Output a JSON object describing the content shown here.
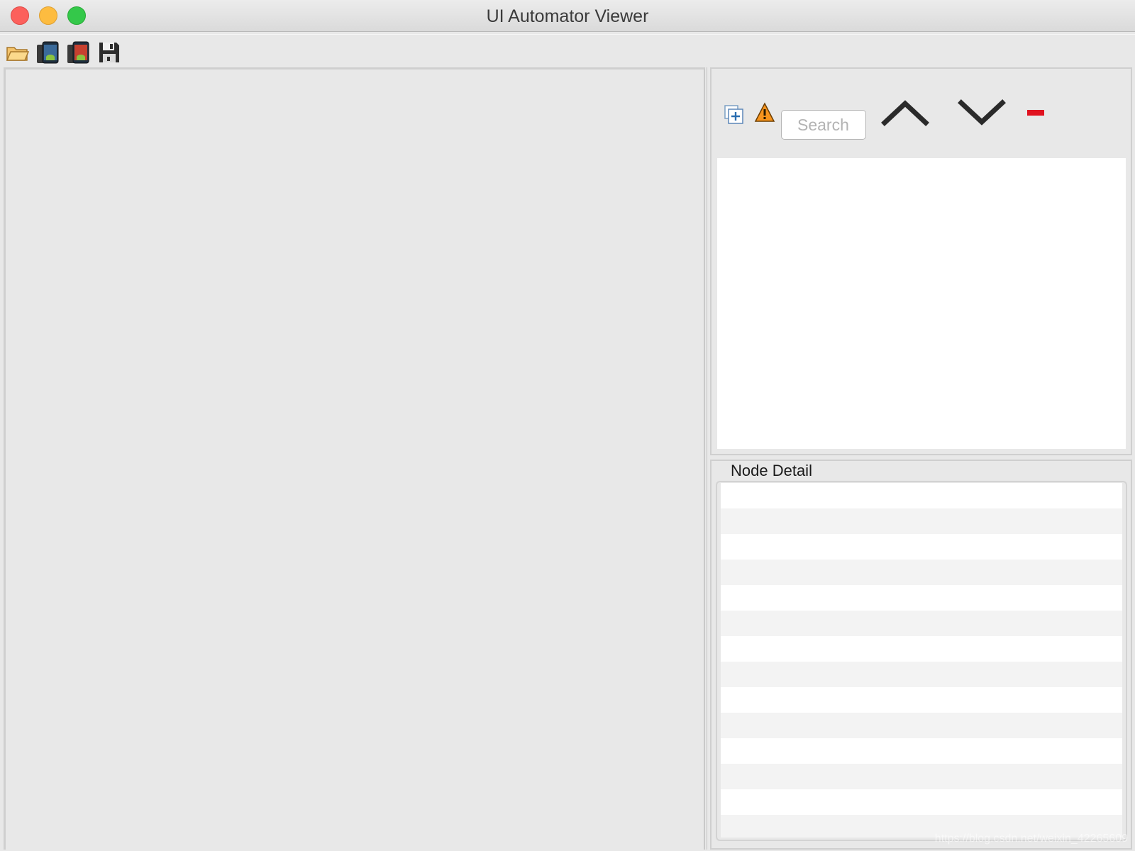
{
  "window": {
    "title": "UI Automator Viewer"
  },
  "toolbar": {
    "items": [
      {
        "icon": "open-folder-icon",
        "label": "Open"
      },
      {
        "icon": "device-screenshot-icon",
        "label": "Device Screenshot"
      },
      {
        "icon": "device-screenshot-compressed-icon",
        "label": "Device Screenshot (compressed)"
      },
      {
        "icon": "save-icon",
        "label": "Save"
      }
    ]
  },
  "tree_toolbar": {
    "expand_all_icon": "expand-all-icon",
    "warning_icon": "warning-icon",
    "search": {
      "placeholder": "Search",
      "value": ""
    },
    "prev_icon": "chevron-up-icon",
    "next_icon": "chevron-down-icon",
    "clear_icon": "minus-icon",
    "colors": {
      "warning": "#f7941d",
      "clear": "#e0121f",
      "expand": "#2a6db0"
    }
  },
  "node_detail": {
    "title": "Node Detail",
    "row_count": 14
  },
  "watermark": "https://blog.csdn.net/weixin_42265609"
}
